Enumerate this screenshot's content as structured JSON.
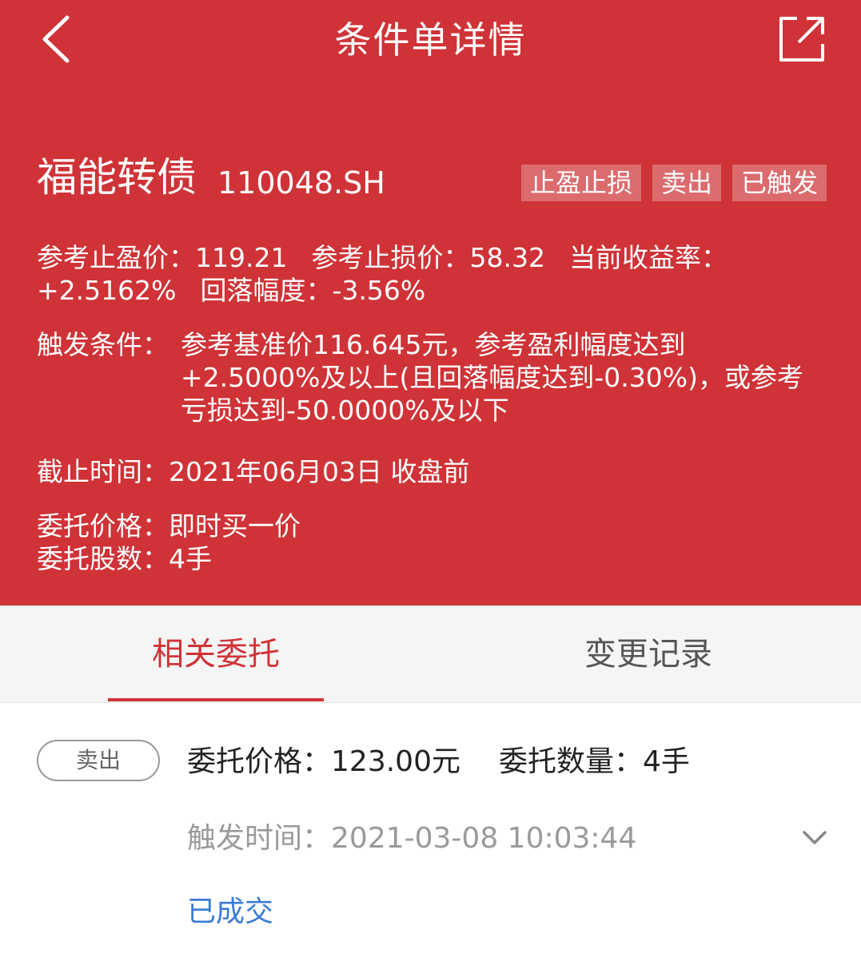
{
  "nav": {
    "title": "条件单详情",
    "back_icon": "chevron-left-icon",
    "share_icon": "share-external-icon"
  },
  "stock": {
    "name": "福能转债",
    "code": "110048.SH",
    "tags": [
      "止盈止损",
      "卖出",
      "已触发"
    ]
  },
  "details": {
    "tp_label": "参考止盈价：",
    "tp_value": "119.21",
    "sl_label": "参考止损价：",
    "sl_value": "58.32",
    "return_label": "当前收益率：",
    "return_value": "+2.5162%",
    "pullback_label": "回落幅度：",
    "pullback_value": "-3.56%",
    "trigger_label": "触发条件：",
    "trigger_lines": [
      "参考基准价116.645元，参考盈利幅度达到",
      "+2.5000%及以上(且回落幅度达到-0.30%)，或参考",
      "亏损达到-50.0000%及以下"
    ],
    "deadline_label": "截止时间：",
    "deadline_value": "2021年06月03日 收盘前",
    "entrust_price_label": "委托价格：",
    "entrust_price_value": "即时买一价",
    "entrust_shares_label": "委托股数：",
    "entrust_shares_value": "4手"
  },
  "tabs": [
    {
      "label": "相关委托",
      "active": true
    },
    {
      "label": "变更记录",
      "active": false
    }
  ],
  "order": {
    "side": "卖出",
    "price_label": "委托价格：",
    "price_value": "123.00元",
    "qty_label": "委托数量：",
    "qty_value": "4手",
    "time_label": "触发时间：",
    "time_value": "2021-03-08 10:03:44",
    "status": "已成交",
    "expand_icon": "chevron-down-icon"
  },
  "colors": {
    "brand_red": "#cf3337",
    "status_blue": "#3a7bd5"
  }
}
